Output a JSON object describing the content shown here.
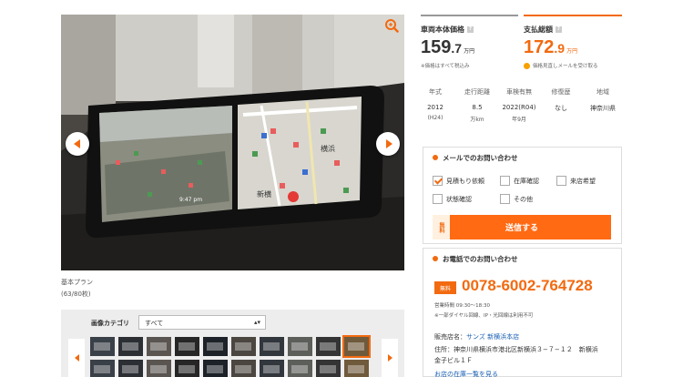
{
  "viewer": {
    "caption_plan": "基本プラン",
    "caption_count": "(63/80枚)",
    "screen_left_text": "9:47 pm",
    "screen_right_text": "横浜",
    "screen_right_text2": "新横"
  },
  "thumbnails": {
    "category_label": "画像カテゴリ",
    "category_selected": "すべて",
    "colors": [
      "#3a4048",
      "#2c2f34",
      "#5a5550",
      "#262626",
      "#1d2228",
      "#4b4640",
      "#32373d",
      "#5d5f5a",
      "#343434",
      "#705a3c"
    ]
  },
  "price": {
    "body": {
      "label": "車両本体価格",
      "int": "159",
      "dec": ".7",
      "unit": "万円",
      "note": "※価格はすべて税込み"
    },
    "total": {
      "label": "支払総額",
      "int": "172",
      "dec": ".9",
      "unit": "万円",
      "note": "価格見直しメールを受け取る"
    },
    "help": "?"
  },
  "specs": [
    {
      "label": "年式",
      "v1": "2012",
      "v2": "(H24)"
    },
    {
      "label": "走行距離",
      "v1": "8.5",
      "v2": "万km"
    },
    {
      "label": "車検有無",
      "v1": "2022(R04)",
      "v2": "年9月"
    },
    {
      "label": "修復歴",
      "v1": "なし",
      "v2": ""
    },
    {
      "label": "地域",
      "v1": "神奈川県",
      "v2": ""
    }
  ],
  "mail": {
    "title": "メールでのお問い合わせ",
    "options": [
      {
        "label": "見積もり依頼",
        "checked": true
      },
      {
        "label": "在庫確認",
        "checked": false
      },
      {
        "label": "来店希望",
        "checked": false
      },
      {
        "label": "状態確認",
        "checked": false
      },
      {
        "label": "その他",
        "checked": false
      }
    ],
    "free": "無料",
    "send": "送信する"
  },
  "phone": {
    "title": "お電話でのお問い合わせ",
    "free": "無料",
    "number": "0078-6002-764728",
    "hours": "営業時間 09:30〜18:30",
    "note": "※一部ダイヤル回線、IP・光回線は利用不可",
    "shop_label": "販売店名：",
    "shop_name": "サンズ 新横浜本店",
    "address1": "住所：神奈川県横浜市港北区新横浜３−７−１２　新横浜",
    "address2": "金子ビル１Ｆ",
    "more": "お店の在庫一覧を見る"
  }
}
